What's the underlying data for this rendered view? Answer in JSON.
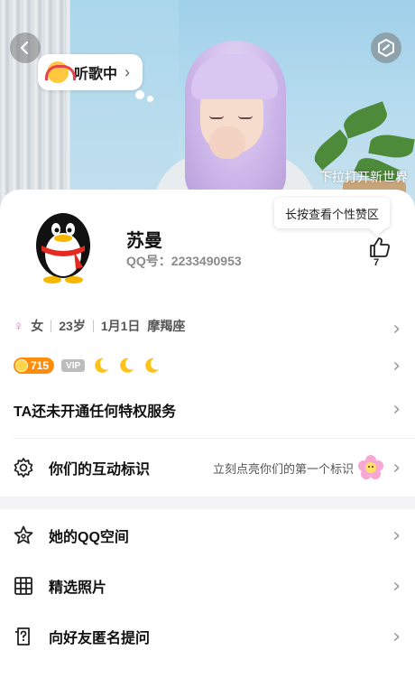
{
  "header": {
    "bubble_text": "听歌中",
    "pull_hint": "下拉打开新世界"
  },
  "profile": {
    "nickname": "苏曼",
    "qq_line": "QQ号：2233490953",
    "like_tooltip": "长按查看个性赞区",
    "like_count": "7"
  },
  "info": {
    "gender": "女",
    "age": "23岁",
    "birthday": "1月1日",
    "zodiac": "摩羯座"
  },
  "badges": {
    "coin_value": "715",
    "vip_label": "VIP"
  },
  "service_text": "TA还未开通任何特权服务",
  "interaction": {
    "label": "你们的互动标识",
    "hint": "立刻点亮你们的第一个标识"
  },
  "menu": [
    {
      "label": "她的QQ空间",
      "icon": "star-icon"
    },
    {
      "label": "精选照片",
      "icon": "grid-icon"
    },
    {
      "label": "向好友匿名提问",
      "icon": "question-card-icon"
    }
  ],
  "colors": {
    "female_pink": "#e572c0",
    "coin_orange": "#ff8d0c",
    "moon_yellow": "#ffc21a"
  }
}
